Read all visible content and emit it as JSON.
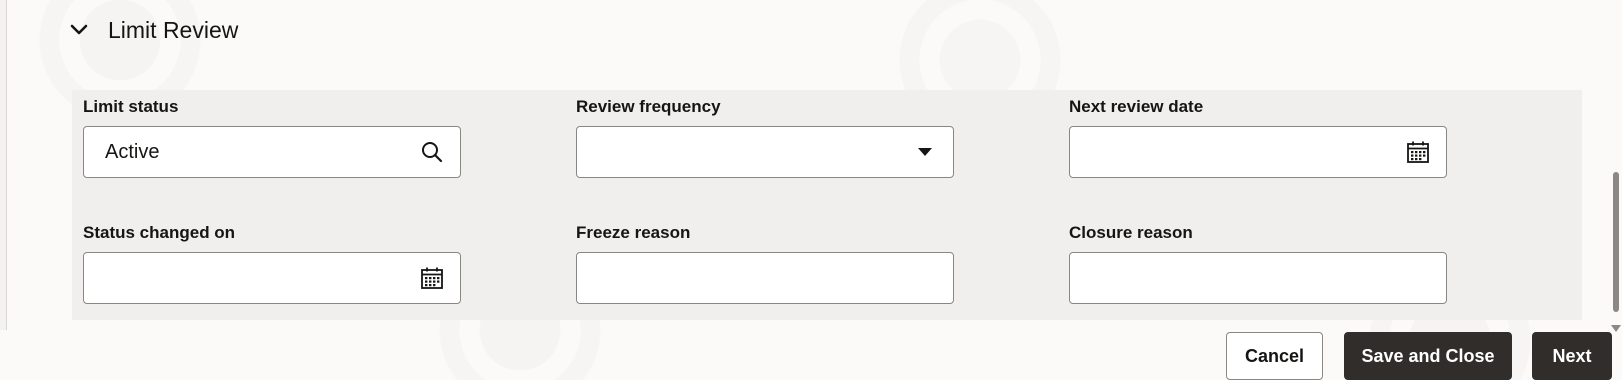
{
  "section": {
    "title": "Limit Review",
    "chevron_icon": "chevron-down-icon"
  },
  "fields": {
    "limit_status": {
      "label": "Limit status",
      "value": "Active",
      "icon": "search-icon"
    },
    "review_frequency": {
      "label": "Review frequency",
      "value": "",
      "icon": "caret-down-icon"
    },
    "next_review_date": {
      "label": "Next review date",
      "value": "",
      "icon": "calendar-icon"
    },
    "status_changed_on": {
      "label": "Status changed on",
      "value": "",
      "icon": "calendar-icon"
    },
    "freeze_reason": {
      "label": "Freeze reason",
      "value": ""
    },
    "closure_reason": {
      "label": "Closure reason",
      "value": ""
    }
  },
  "actions": {
    "cancel": "Cancel",
    "save_close": "Save and Close",
    "next": "Next"
  },
  "colors": {
    "primary_button": "#312d2a",
    "panel_background": "#f1efed",
    "border": "#8a8683"
  }
}
